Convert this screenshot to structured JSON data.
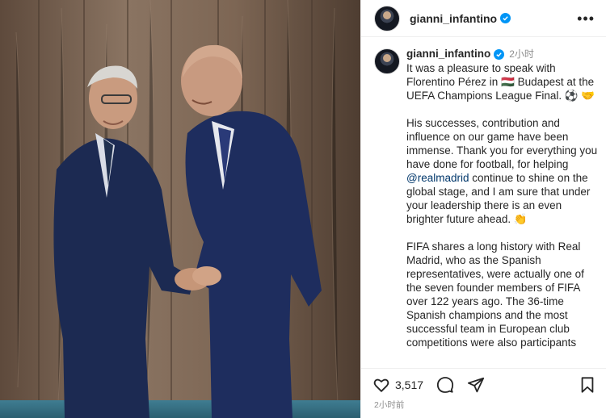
{
  "post": {
    "username": "gianni_infantino",
    "more_label": "•••"
  },
  "caption": {
    "username": "gianni_infantino",
    "time": "2小时",
    "para1": "It was a pleasure to speak with Florentino Pérez in 🇭🇺 Budapest at the UEFA Champions League Final. ⚽ 🤝",
    "para2_a": "His successes, contribution and influence on our game have been immense. Thank you for everything you have done for football, for helping ",
    "mention": "@realmadrid",
    "para2_b": " continue to shine on the global stage, and I am sure that under your leadership there is an even brighter future ahead. 👏",
    "para3": "FIFA shares a long history with Real Madrid, who as the Spanish representatives, were actually one of the seven founder members of FIFA over 122 years ago. The 36-time Spanish champions and the most successful team in European club competitions were also participants"
  },
  "actions": {
    "likes": "3,517",
    "timestamp": "2小时前"
  },
  "icons": {
    "like": "heart-icon",
    "comment": "comment-icon",
    "share": "share-icon",
    "save": "bookmark-icon",
    "verified": "verified-badge-icon"
  },
  "colors": {
    "verified": "#0095f6",
    "mention": "#00376b",
    "muted": "#8e8e8e"
  }
}
